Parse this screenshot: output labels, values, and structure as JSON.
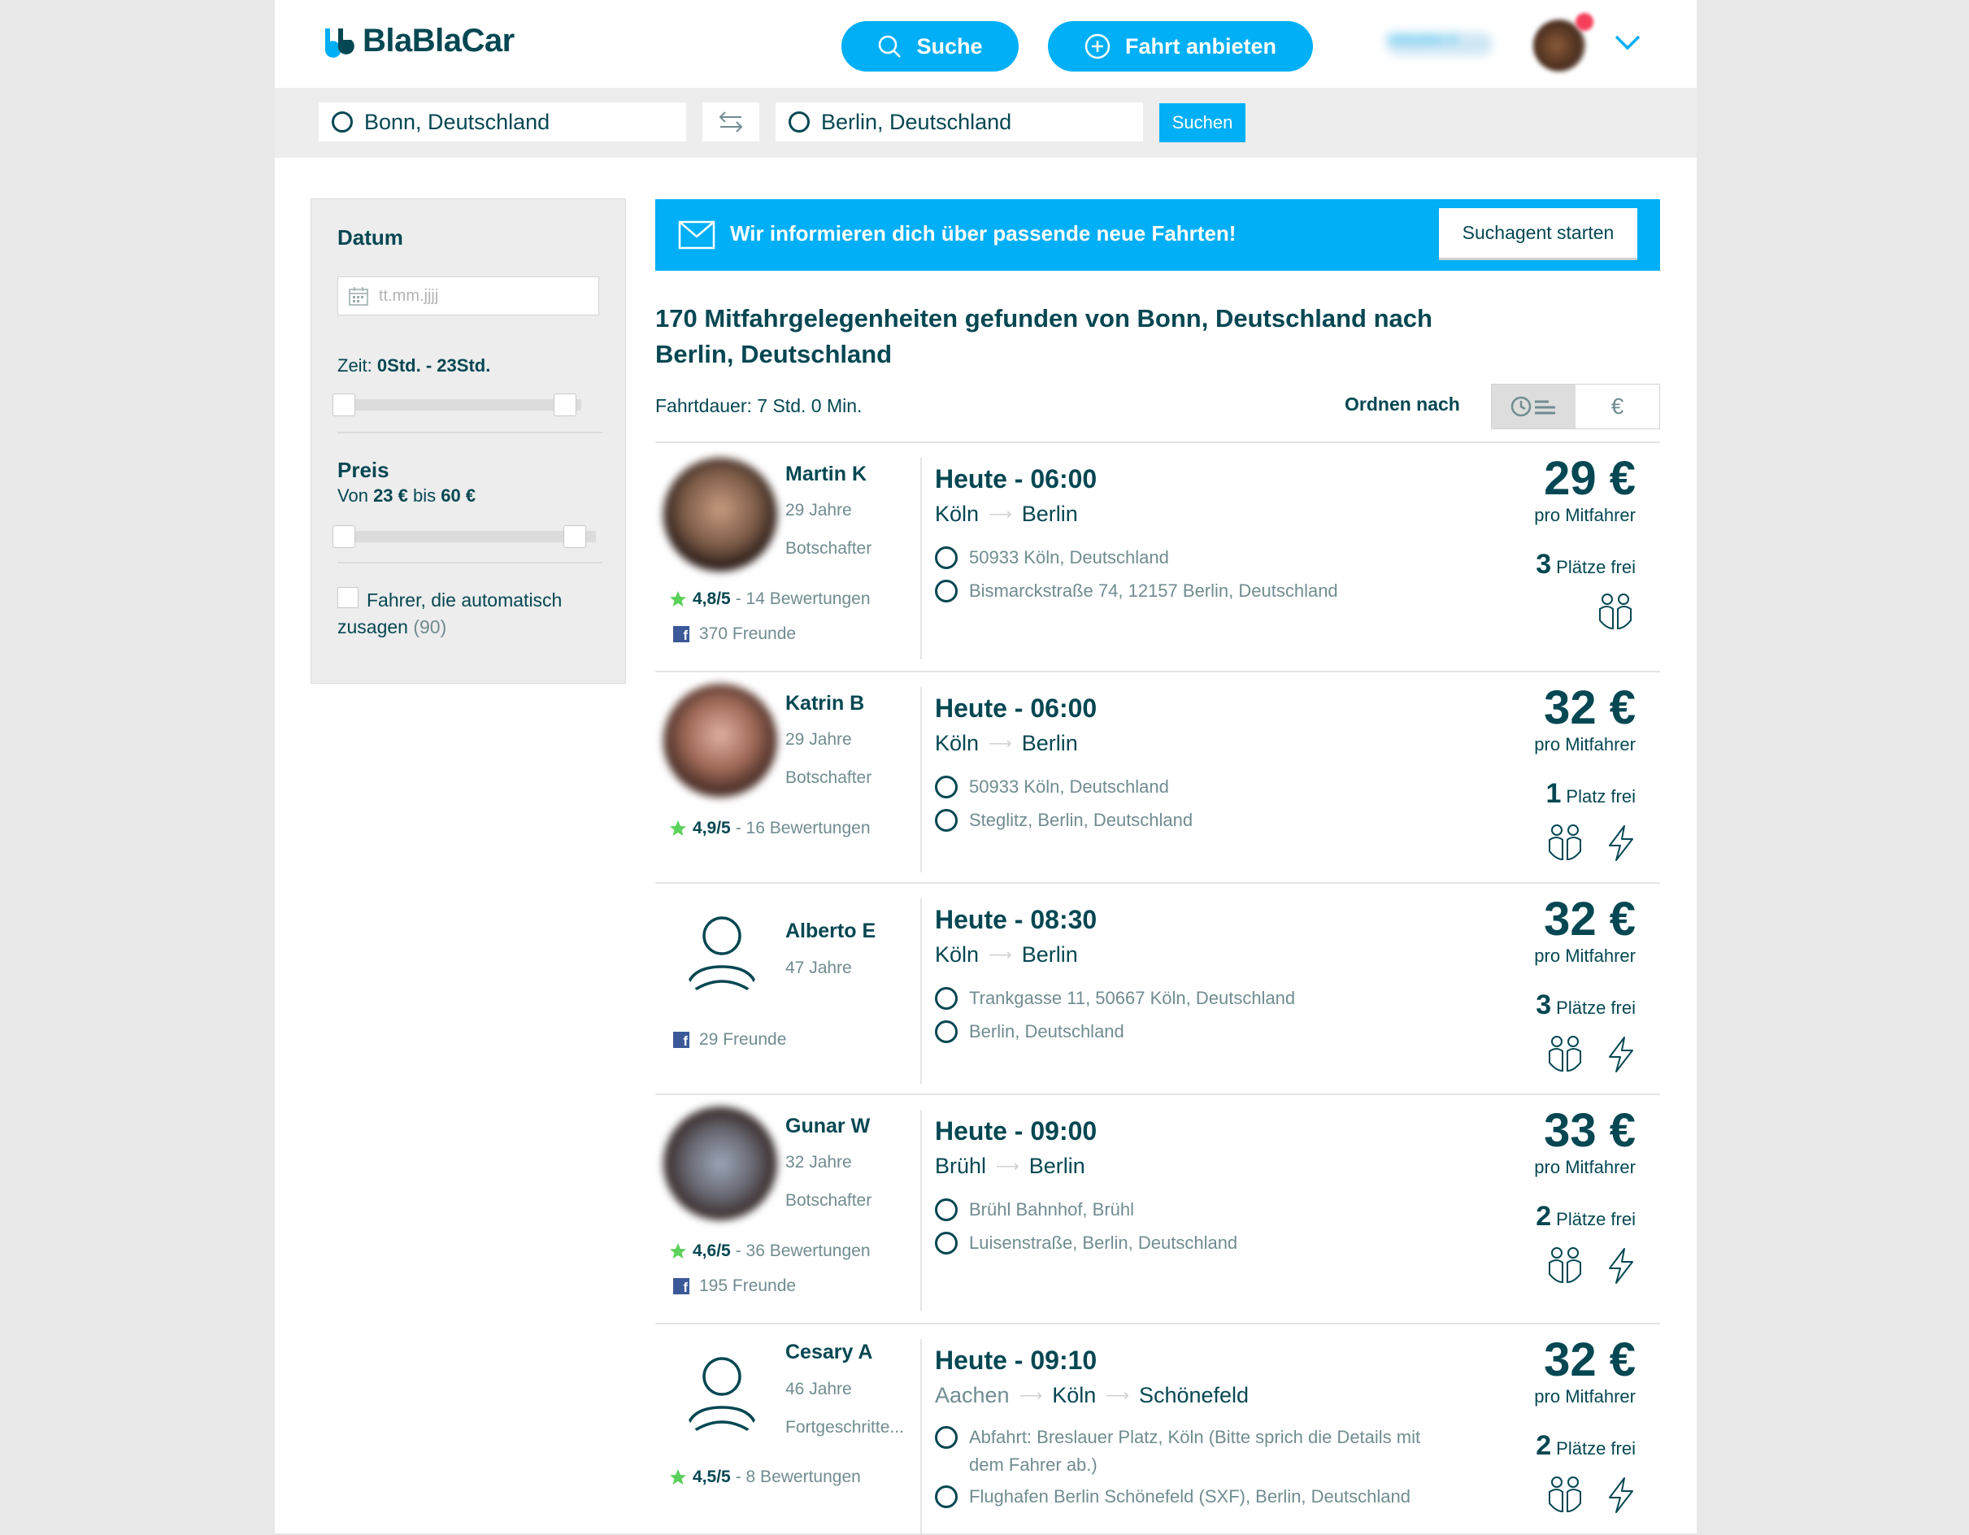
{
  "header": {
    "logo_text": "BlaBlaCar",
    "search_button": "Suche",
    "offer_button": "Fahrt anbieten",
    "user_name": "Sebastian H"
  },
  "searchbar": {
    "from": "Bonn, Deutschland",
    "to": "Berlin, Deutschland",
    "submit": "Suchen"
  },
  "filters": {
    "date_title": "Datum",
    "date_placeholder": "tt.mm.jjjj",
    "time_prefix": "Zeit:",
    "time_from": "0Std.",
    "time_sep": "-",
    "time_to": "23Std.",
    "time_range": [
      0,
      23
    ],
    "price_title": "Preis",
    "price_from_label": "Von",
    "price_from": "23 €",
    "price_to_label": "bis",
    "price_to": "60 €",
    "price_range": [
      23,
      60
    ],
    "auto_accept_label": "Fahrer, die automatisch zusagen",
    "auto_accept_count": "(90)"
  },
  "banner": {
    "text": "Wir informieren dich über passende neue Fahrten!",
    "button": "Suchagent starten"
  },
  "results": {
    "title": "170 Mitfahrgelegenheiten gefunden von Bonn, Deutschland nach Berlin, Deutschland",
    "duration": "Fahrtdauer: 7 Std. 0 Min.",
    "sort_label": "Ordnen nach",
    "sort_price_symbol": "€"
  },
  "trips": [
    {
      "name": "Martin K",
      "age": "29 Jahre",
      "level": "Botschafter",
      "rating": "4,8/5",
      "reviews": "- 14 Bewertungen",
      "friends": "370 Freunde",
      "time": "Heute - 06:00",
      "route": [
        "Köln",
        "Berlin"
      ],
      "stop_from": "50933 Köln, Deutschland",
      "stop_to": "Bismarckstraße 74, 12157 Berlin, Deutschland",
      "price": "29 €",
      "per": "pro Mitfahrer",
      "seats_num": "3",
      "seats_label": "Plätze frei",
      "instant": false
    },
    {
      "name": "Katrin B",
      "age": "29 Jahre",
      "level": "Botschafter",
      "rating": "4,9/5",
      "reviews": "- 16 Bewertungen",
      "friends": "",
      "time": "Heute - 06:00",
      "route": [
        "Köln",
        "Berlin"
      ],
      "stop_from": "50933 Köln, Deutschland",
      "stop_to": "Steglitz, Berlin, Deutschland",
      "price": "32 €",
      "per": "pro Mitfahrer",
      "seats_num": "1",
      "seats_label": "Platz frei",
      "instant": true
    },
    {
      "name": "Alberto E",
      "age": "47 Jahre",
      "level": "",
      "rating": "",
      "reviews": "",
      "friends": "29 Freunde",
      "time": "Heute - 08:30",
      "route": [
        "Köln",
        "Berlin"
      ],
      "stop_from": "Trankgasse 11, 50667 Köln, Deutschland",
      "stop_to": "Berlin, Deutschland",
      "price": "32 €",
      "per": "pro Mitfahrer",
      "seats_num": "3",
      "seats_label": "Plätze frei",
      "instant": true
    },
    {
      "name": "Gunar W",
      "age": "32 Jahre",
      "level": "Botschafter",
      "rating": "4,6/5",
      "reviews": "- 36 Bewertungen",
      "friends": "195 Freunde",
      "time": "Heute - 09:00",
      "route": [
        "Brühl",
        "Berlin"
      ],
      "stop_from": "Brühl Bahnhof, Brühl",
      "stop_to": "Luisenstraße, Berlin, Deutschland",
      "price": "33 €",
      "per": "pro Mitfahrer",
      "seats_num": "2",
      "seats_label": "Plätze frei",
      "instant": true
    },
    {
      "name": "Cesary A",
      "age": "46 Jahre",
      "level": "Fortgeschritte...",
      "rating": "4,5/5",
      "reviews": "- 8 Bewertungen",
      "friends": "",
      "time": "Heute - 09:10",
      "route": [
        "Aachen",
        "Köln",
        "Schönefeld"
      ],
      "stop_from": "Abfahrt: Breslauer Platz, Köln (Bitte sprich die Details mit dem Fahrer ab.)",
      "stop_to": "Flughafen Berlin Schönefeld (SXF), Berlin, Deutschland",
      "price": "32 €",
      "per": "pro Mitfahrer",
      "seats_num": "2",
      "seats_label": "Plätze frei",
      "instant": true
    }
  ],
  "colors": {
    "brand_blue": "#00aff5",
    "text_dark": "#054752",
    "text_muted": "#708c91",
    "star_green": "#5bd15b",
    "facebook": "#3b5998"
  },
  "icons": [
    "search-icon",
    "plus-circle-icon",
    "chevron-down-icon",
    "swap-icon",
    "calendar-icon",
    "mail-icon",
    "clock-icon",
    "star-icon",
    "facebook-icon",
    "seats-icon",
    "lightning-icon",
    "default-avatar-icon"
  ]
}
